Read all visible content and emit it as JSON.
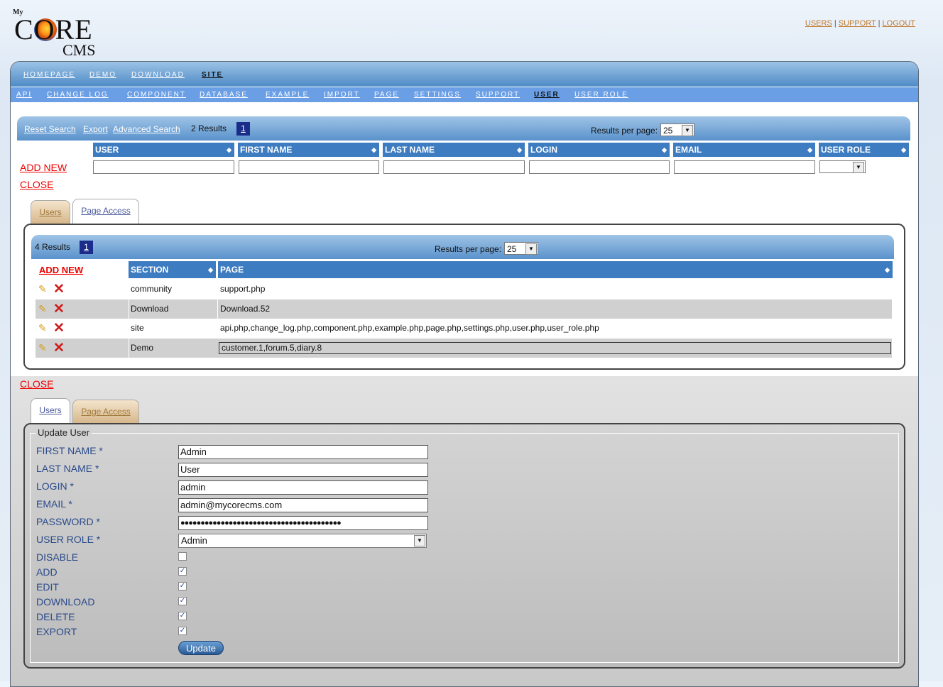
{
  "logo": {
    "my": "My",
    "core": "CORE",
    "cms": "CMS"
  },
  "top_links": {
    "users": "USERS",
    "sep1": " | ",
    "support": "SUPPORT",
    "sep2": " | ",
    "logout": "LOGOUT"
  },
  "nav_primary": [
    "HOMEPAGE",
    "DEMO",
    "DOWNLOAD",
    "SITE"
  ],
  "nav_secondary": [
    "API",
    "CHANGE LOG",
    "COMPONENT",
    "DATABASE",
    "EXAMPLE",
    "IMPORT",
    "PAGE",
    "SETTINGS",
    "SUPPORT",
    "USER",
    "USER ROLE"
  ],
  "search_bar": {
    "reset": "Reset Search",
    "export": "Export",
    "advanced": "Advanced Search",
    "results": "2 Results",
    "page": "1",
    "rpp_label": "Results per page:",
    "rpp_value": "25"
  },
  "user_table": {
    "headers": [
      "USER",
      "FIRST NAME",
      "LAST NAME",
      "LOGIN",
      "EMAIL",
      "USER ROLE"
    ]
  },
  "links": {
    "add_new": "ADD NEW",
    "close": "CLOSE"
  },
  "tabs": {
    "users": "Users",
    "page_access": "Page Access"
  },
  "access_bar": {
    "results": "4 Results",
    "page": "1",
    "rpp_label": "Results per page:",
    "rpp_value": "25"
  },
  "access_table": {
    "headers": [
      "SECTION",
      "PAGE"
    ],
    "rows": [
      {
        "section": "community",
        "page": "support.php"
      },
      {
        "section": "Download",
        "page": "Download.52"
      },
      {
        "section": "site",
        "page": "api.php,change_log.php,component.php,example.php,page.php,settings.php,user.php,user_role.php"
      },
      {
        "section": "Demo",
        "page": "customer.1,forum.5,diary.8"
      }
    ]
  },
  "form": {
    "legend": "Update User",
    "first_name_label": "FIRST NAME *",
    "first_name": "Admin",
    "last_name_label": "LAST NAME *",
    "last_name": "User",
    "login_label": "LOGIN *",
    "login": "admin",
    "email_label": "EMAIL *",
    "email": "admin@mycorecms.com",
    "password_label": "PASSWORD *",
    "password": "●●●●●●●●●●●●●●●●●●●●●●●●●●●●●●●●●●●●●●●●",
    "role_label": "USER ROLE *",
    "role": "Admin",
    "disable_label": "DISABLE",
    "disable": false,
    "add_label": "ADD",
    "add": true,
    "edit_label": "EDIT",
    "edit": true,
    "download_label": "DOWNLOAD",
    "download": true,
    "delete_label": "DELETE",
    "delete": true,
    "export_label": "EXPORT",
    "export": true,
    "submit": "Update"
  }
}
